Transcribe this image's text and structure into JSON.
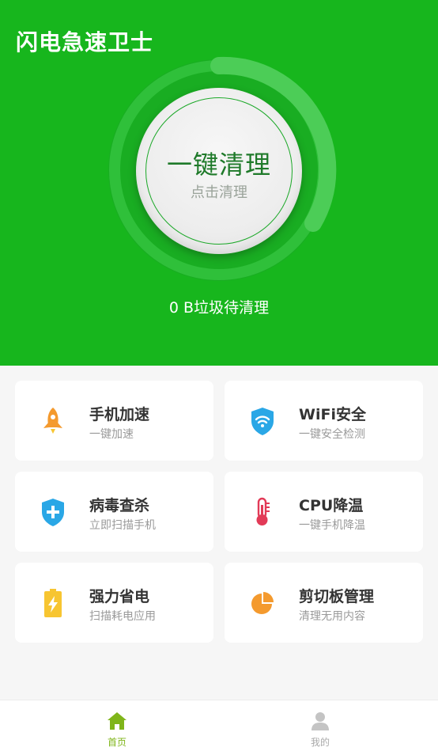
{
  "app": {
    "title": "闪电急速卫士"
  },
  "cleaner": {
    "main_label": "一键清理",
    "sub_label": "点击清理",
    "status": "0 B垃圾待清理"
  },
  "features": [
    {
      "title": "手机加速",
      "desc": "一键加速",
      "icon": "rocket-icon",
      "color": "#f49a2e"
    },
    {
      "title": "WiFi安全",
      "desc": "一键安全检测",
      "icon": "wifi-shield-icon",
      "color": "#2aa7e6"
    },
    {
      "title": "病毒查杀",
      "desc": "立即扫描手机",
      "icon": "shield-plus-icon",
      "color": "#2aa7e6"
    },
    {
      "title": "CPU降温",
      "desc": "一键手机降温",
      "icon": "thermometer-icon",
      "color": "#e23a57"
    },
    {
      "title": "强力省电",
      "desc": "扫描耗电应用",
      "icon": "battery-icon",
      "color": "#f7c531"
    },
    {
      "title": "剪切板管理",
      "desc": "清理无用内容",
      "icon": "pie-chart-icon",
      "color": "#f49a2e"
    }
  ],
  "bottom_nav": {
    "home_label": "首页",
    "mine_label": "我的",
    "active_color": "#7fb51a",
    "inactive_color": "#a9a9a9"
  },
  "colors": {
    "brand_green": "#17b61d"
  }
}
